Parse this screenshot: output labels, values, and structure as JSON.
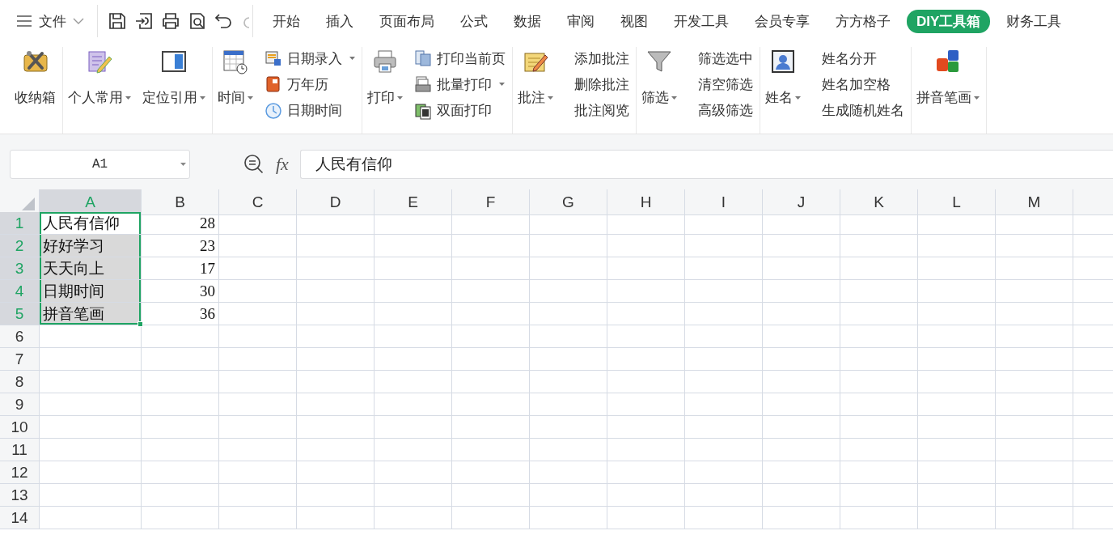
{
  "menu": {
    "label": "文件"
  },
  "tabs": [
    {
      "label": "开始",
      "selected": false
    },
    {
      "label": "插入",
      "selected": false
    },
    {
      "label": "页面布局",
      "selected": false
    },
    {
      "label": "公式",
      "selected": false
    },
    {
      "label": "数据",
      "selected": false
    },
    {
      "label": "审阅",
      "selected": false
    },
    {
      "label": "视图",
      "selected": false
    },
    {
      "label": "开发工具",
      "selected": false
    },
    {
      "label": "会员专享",
      "selected": false
    },
    {
      "label": "方方格子",
      "selected": false
    },
    {
      "label": "DIY工具箱",
      "selected": true
    },
    {
      "label": "财务工具",
      "selected": false
    }
  ],
  "ribbon": {
    "groups": [
      {
        "items": [
          {
            "kind": "large",
            "label": "收纳箱",
            "dropdown": false
          }
        ]
      },
      {
        "items": [
          {
            "kind": "large",
            "label": "个人常用",
            "dropdown": true
          },
          {
            "kind": "large",
            "label": "定位引用",
            "dropdown": true
          }
        ]
      },
      {
        "items": [
          {
            "kind": "large",
            "label": "时间",
            "dropdown": true
          },
          {
            "kind": "stack",
            "entries": [
              {
                "label": "日期录入",
                "dropdown": true
              },
              {
                "label": "万年历",
                "dropdown": false
              },
              {
                "label": "日期时间",
                "dropdown": false
              }
            ]
          }
        ]
      },
      {
        "items": [
          {
            "kind": "large",
            "label": "打印",
            "dropdown": true
          },
          {
            "kind": "stack",
            "entries": [
              {
                "label": "打印当前页",
                "dropdown": false
              },
              {
                "label": "批量打印",
                "dropdown": true
              },
              {
                "label": "双面打印",
                "dropdown": false
              }
            ]
          }
        ]
      },
      {
        "items": [
          {
            "kind": "large",
            "label": "批注",
            "dropdown": true
          },
          {
            "kind": "text-stack",
            "entries": [
              {
                "label": "添加批注",
                "dropdown": false
              },
              {
                "label": "删除批注",
                "dropdown": false
              },
              {
                "label": "批注阅览",
                "dropdown": false
              }
            ]
          }
        ]
      },
      {
        "items": [
          {
            "kind": "large",
            "label": "筛选",
            "dropdown": true
          },
          {
            "kind": "text-stack",
            "entries": [
              {
                "label": "筛选选中",
                "dropdown": false
              },
              {
                "label": "清空筛选",
                "dropdown": false
              },
              {
                "label": "高级筛选",
                "dropdown": false
              }
            ]
          }
        ]
      },
      {
        "items": [
          {
            "kind": "large",
            "label": "姓名",
            "dropdown": true
          },
          {
            "kind": "text-stack",
            "entries": [
              {
                "label": "姓名分开",
                "dropdown": false
              },
              {
                "label": "姓名加空格",
                "dropdown": false
              },
              {
                "label": "生成随机姓名",
                "dropdown": false
              }
            ]
          }
        ]
      },
      {
        "items": [
          {
            "kind": "large",
            "label": "拼音笔画",
            "dropdown": true
          }
        ]
      }
    ]
  },
  "formula_bar": {
    "name_box": "A1",
    "fx": "fx",
    "value": "人民有信仰"
  },
  "sheet": {
    "columns": [
      {
        "label": "A",
        "selected": true
      },
      {
        "label": "B",
        "selected": false
      },
      {
        "label": "C",
        "selected": false
      },
      {
        "label": "D",
        "selected": false
      },
      {
        "label": "E",
        "selected": false
      },
      {
        "label": "F",
        "selected": false
      },
      {
        "label": "G",
        "selected": false
      },
      {
        "label": "H",
        "selected": false
      },
      {
        "label": "I",
        "selected": false
      },
      {
        "label": "J",
        "selected": false
      },
      {
        "label": "K",
        "selected": false
      },
      {
        "label": "L",
        "selected": false
      },
      {
        "label": "M",
        "selected": false
      }
    ],
    "rows": [
      {
        "header": "1",
        "a": "人民有信仰",
        "b": "28",
        "selected": true,
        "active": true
      },
      {
        "header": "2",
        "a": "好好学习",
        "b": "23",
        "selected": true,
        "active": false
      },
      {
        "header": "3",
        "a": "天天向上",
        "b": "17",
        "selected": true,
        "active": false
      },
      {
        "header": "4",
        "a": "日期时间",
        "b": "30",
        "selected": true,
        "active": false
      },
      {
        "header": "5",
        "a": "拼音笔画",
        "b": "36",
        "selected": true,
        "active": false
      },
      {
        "header": "6",
        "selected": false,
        "active": false
      },
      {
        "header": "7",
        "selected": false,
        "active": false
      },
      {
        "header": "8",
        "selected": false,
        "active": false
      },
      {
        "header": "9",
        "selected": false,
        "active": false
      },
      {
        "header": "10",
        "selected": false,
        "active": false
      },
      {
        "header": "11",
        "selected": false,
        "active": false
      },
      {
        "header": "12",
        "selected": false,
        "active": false
      },
      {
        "header": "13",
        "selected": false,
        "active": false
      },
      {
        "header": "14",
        "selected": false,
        "active": false
      }
    ]
  }
}
